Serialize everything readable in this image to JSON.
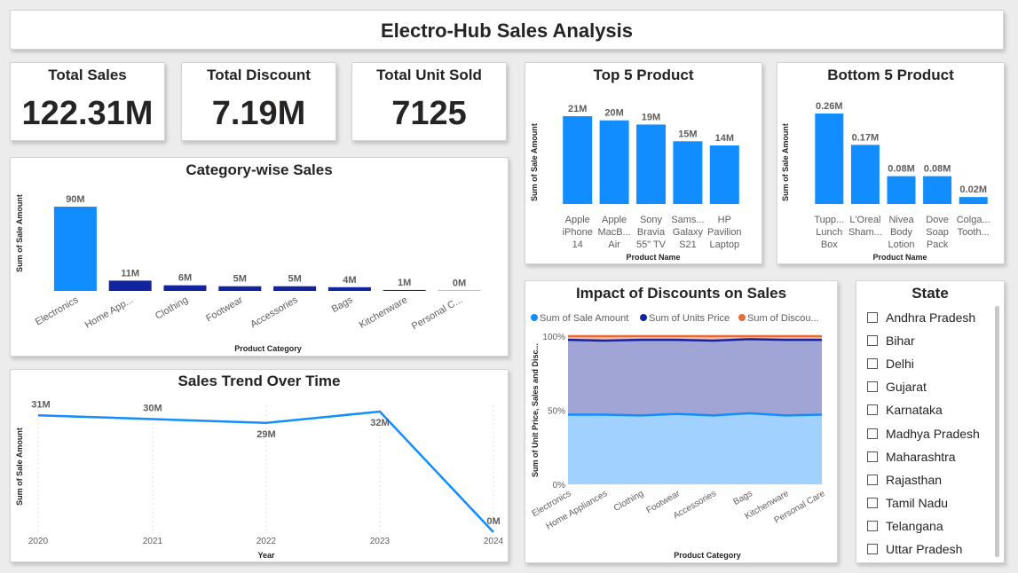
{
  "title": "Electro-Hub Sales Analysis",
  "kpis": [
    {
      "label": "Total Sales",
      "value": "122.31M"
    },
    {
      "label": "Total Discount",
      "value": "7.19M"
    },
    {
      "label": "Total Unit Sold",
      "value": "7125"
    }
  ],
  "colors": {
    "primary": "#118dff",
    "dark": "#12239e",
    "orange": "#e66c37",
    "area_light": "#a0d1ff",
    "area_purple": "#a0a5d6"
  },
  "top5": {
    "title": "Top 5 Product",
    "chart_data": {
      "type": "bar",
      "categories": [
        [
          "Apple",
          "iPhone",
          "14"
        ],
        [
          "Apple",
          "MacB...",
          "Air"
        ],
        [
          "Sony",
          "Bravia",
          "55\" TV"
        ],
        [
          "Sams...",
          "Galaxy",
          "S21"
        ],
        [
          "HP",
          "Pavilion",
          "Laptop"
        ]
      ],
      "values": [
        21,
        20,
        19,
        15,
        14
      ],
      "labels": [
        "21M",
        "20M",
        "19M",
        "15M",
        "14M"
      ],
      "ylabel": "Sum of Sale Amount",
      "xlabel": "Product Name"
    }
  },
  "bottom5": {
    "title": "Bottom 5 Product",
    "chart_data": {
      "type": "bar",
      "categories": [
        [
          "Tupp...",
          "Lunch",
          "Box"
        ],
        [
          "L'Oreal",
          "Sham..."
        ],
        [
          "Nivea",
          "Body",
          "Lotion"
        ],
        [
          "Dove",
          "Soap",
          "Pack"
        ],
        [
          "Colga...",
          "Tooth..."
        ]
      ],
      "values": [
        0.26,
        0.17,
        0.08,
        0.08,
        0.02
      ],
      "labels": [
        "0.26M",
        "0.17M",
        "0.08M",
        "0.08M",
        "0.02M"
      ],
      "ylabel": "Sum of Sale Amount",
      "xlabel": "Product Name"
    }
  },
  "category": {
    "title": "Category-wise Sales",
    "chart_data": {
      "type": "bar",
      "categories": [
        "Electronics",
        "Home App...",
        "Clothing",
        "Footwear",
        "Accessories",
        "Bags",
        "Kitchenware",
        "Personal C..."
      ],
      "values": [
        90,
        11,
        6,
        5,
        5,
        4,
        1,
        0.3
      ],
      "labels": [
        "90M",
        "11M",
        "6M",
        "5M",
        "5M",
        "4M",
        "1M",
        "0M"
      ],
      "ylabel": "Sum of Sale Amount",
      "xlabel": "Product Category"
    }
  },
  "trend": {
    "title": "Sales Trend Over Time",
    "chart_data": {
      "type": "line",
      "x": [
        "2020",
        "2021",
        "2022",
        "2023",
        "2024"
      ],
      "values": [
        31,
        30,
        29,
        32,
        0
      ],
      "labels": [
        "31M",
        "30M",
        "29M",
        "32M",
        "0M"
      ],
      "ylabel": "Sum of Sale Amount",
      "xlabel": "Year"
    }
  },
  "impact": {
    "title": "Impact of Discounts on Sales",
    "chart_data": {
      "type": "area",
      "categories": [
        "Electronics",
        "Home Appliances",
        "Clothing",
        "Footwear",
        "Accessories",
        "Bags",
        "Kitchenware",
        "Personal Care"
      ],
      "series": [
        {
          "name": "Sum of Sale Amount",
          "values": [
            47,
            47,
            46.5,
            47.5,
            46.5,
            48,
            46.5,
            47
          ]
        },
        {
          "name": "Sum of Units Price",
          "values": [
            50.5,
            50,
            51,
            50,
            50.5,
            50,
            51,
            50.5
          ]
        },
        {
          "name": "Sum of Discou...",
          "values": [
            2.5,
            3,
            2.5,
            2.5,
            3,
            2,
            2.5,
            2.5
          ]
        }
      ],
      "yticks": [
        "100%",
        "50%",
        "0%"
      ],
      "ylabel": "Sum of Unit Price, Sales and Disc...",
      "xlabel": "Product Category"
    }
  },
  "state": {
    "title": "State",
    "items": [
      "Andhra Pradesh",
      "Bihar",
      "Delhi",
      "Gujarat",
      "Karnataka",
      "Madhya Pradesh",
      "Maharashtra",
      "Rajasthan",
      "Tamil Nadu",
      "Telangana",
      "Uttar Pradesh"
    ]
  }
}
